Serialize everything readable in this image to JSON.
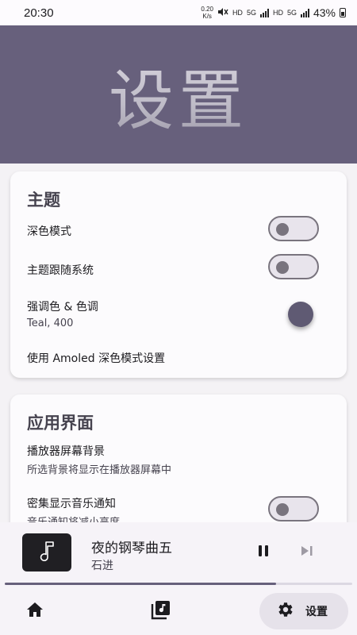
{
  "status_bar": {
    "time": "20:30",
    "speed_value": "0.20",
    "speed_unit": "K/s",
    "hd1": "HD",
    "net1": "5G",
    "hd2": "HD",
    "net2": "5G",
    "battery": "43%",
    "icons": [
      "mute-icon",
      "signal-icon",
      "signal-icon",
      "battery-icon"
    ]
  },
  "header": {
    "title": "设置"
  },
  "theme_card": {
    "title": "主题",
    "dark_mode": {
      "label": "深色模式",
      "on": false
    },
    "follow_system": {
      "label": "主题跟随系统",
      "on": false
    },
    "accent": {
      "label": "强调色 & 色调",
      "value": "Teal, 400",
      "color": "#5f5a73"
    },
    "amoled": {
      "label": "使用 Amoled 深色模式设置"
    }
  },
  "ui_card": {
    "title": "应用界面",
    "player_bg": {
      "label": "播放器屏幕背景",
      "sub": "所选背景将显示在播放器屏幕中"
    },
    "dense_notify": {
      "label": "密集显示音乐通知",
      "sub": "音乐通知将减小高度",
      "on": false
    }
  },
  "player": {
    "title": "夜的钢琴曲五",
    "artist": "石进",
    "progress": 0.78,
    "icons": [
      "music-note-icon",
      "pause-icon",
      "skip-next-icon"
    ]
  },
  "bottom_nav": {
    "settings_label": "设置",
    "icons": [
      "home-icon",
      "library-icon",
      "settings-gear-icon"
    ]
  },
  "colors": {
    "header_bg": "#67607c",
    "switch_border": "#79747e",
    "card_bg": "#fcfbfd",
    "page_bg": "#f4f2f5"
  }
}
